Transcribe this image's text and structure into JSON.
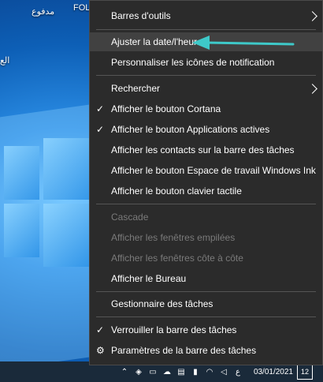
{
  "desktop": {
    "labels": [
      "مدفوع",
      "FOL",
      "الع"
    ]
  },
  "menu": {
    "items": [
      {
        "label": "Barres d'outils",
        "submenu": true,
        "checked": false,
        "disabled": false
      },
      {
        "label": "Ajuster la date/l'heure",
        "submenu": false,
        "checked": false,
        "disabled": false,
        "highlighted": true
      },
      {
        "label": "Personnaliser les icônes de notification",
        "submenu": false,
        "checked": false,
        "disabled": false
      },
      {
        "label": "Rechercher",
        "submenu": true,
        "checked": false,
        "disabled": false
      },
      {
        "label": "Afficher le bouton Cortana",
        "submenu": false,
        "checked": true,
        "disabled": false
      },
      {
        "label": "Afficher le bouton Applications actives",
        "submenu": false,
        "checked": true,
        "disabled": false
      },
      {
        "label": "Afficher les contacts sur la barre des tâches",
        "submenu": false,
        "checked": false,
        "disabled": false
      },
      {
        "label": "Afficher le bouton Espace de travail Windows Ink",
        "submenu": false,
        "checked": false,
        "disabled": false
      },
      {
        "label": "Afficher le bouton clavier tactile",
        "submenu": false,
        "checked": false,
        "disabled": false
      },
      {
        "label": "Cascade",
        "submenu": false,
        "checked": false,
        "disabled": true
      },
      {
        "label": "Afficher les fenêtres empilées",
        "submenu": false,
        "checked": false,
        "disabled": true
      },
      {
        "label": "Afficher les fenêtres côte à côte",
        "submenu": false,
        "checked": false,
        "disabled": true
      },
      {
        "label": "Afficher le Bureau",
        "submenu": false,
        "checked": false,
        "disabled": false
      },
      {
        "label": "Gestionnaire des tâches",
        "submenu": false,
        "checked": false,
        "disabled": false
      },
      {
        "label": "Verrouiller la barre des tâches",
        "submenu": false,
        "checked": true,
        "disabled": false
      },
      {
        "label": "Paramètres de la barre des tâches",
        "submenu": false,
        "checked": false,
        "disabled": false,
        "icon": "gear-icon"
      }
    ],
    "check_glyph": "✓",
    "gear_glyph": "⚙"
  },
  "annotation": {
    "color": "#3ec9c9"
  },
  "taskbar": {
    "language": "ع",
    "date": "03/01/2021",
    "notification_count": "12",
    "tray_icons": [
      "chevron-up-icon",
      "shield-icon",
      "network-icon",
      "cloud-icon",
      "printer-icon",
      "battery-icon",
      "wifi-icon",
      "volume-icon"
    ]
  }
}
